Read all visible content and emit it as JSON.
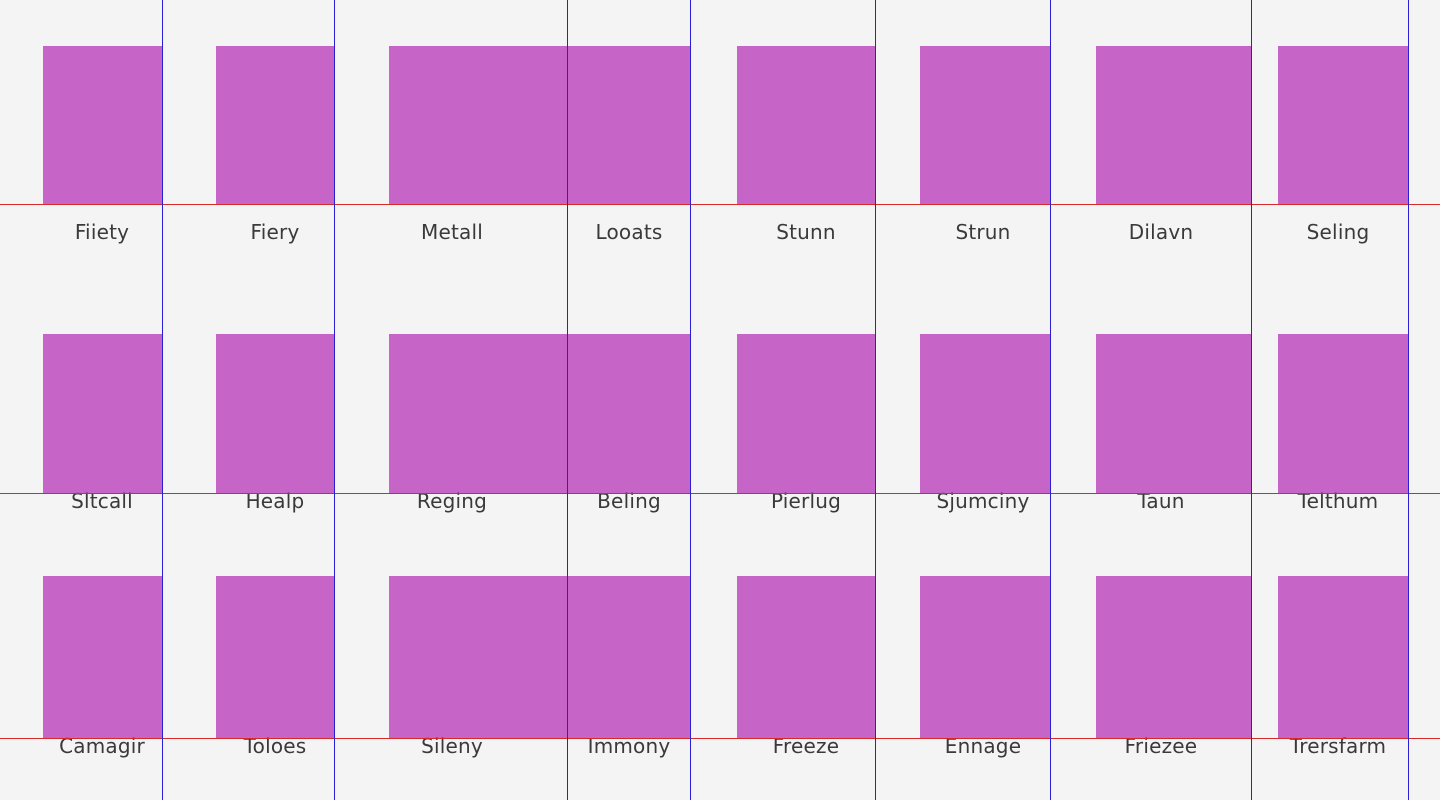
{
  "colors": {
    "background": "#f4f4f4",
    "tile": "#c764c7",
    "label": "#3a3a3a",
    "vertical_guide": "#2a1fd6",
    "horizontal_guide": "#d62a2a"
  },
  "rows": [
    {
      "labels": [
        "Fiiety",
        "Fiery",
        "Metall",
        "Looats",
        "Stunn",
        "Strun",
        "Dilavn",
        "Seling"
      ]
    },
    {
      "labels": [
        "Sltcall",
        "Healp",
        "Reging",
        "Beling",
        "Pierlug",
        "Sjumciny",
        "Taun",
        "Telthum"
      ]
    },
    {
      "labels": [
        "Camagir",
        "Toloes",
        "Sileny",
        "Immony",
        "Freeze",
        "Ennage",
        "Friezee",
        "Trersfarm"
      ]
    }
  ]
}
